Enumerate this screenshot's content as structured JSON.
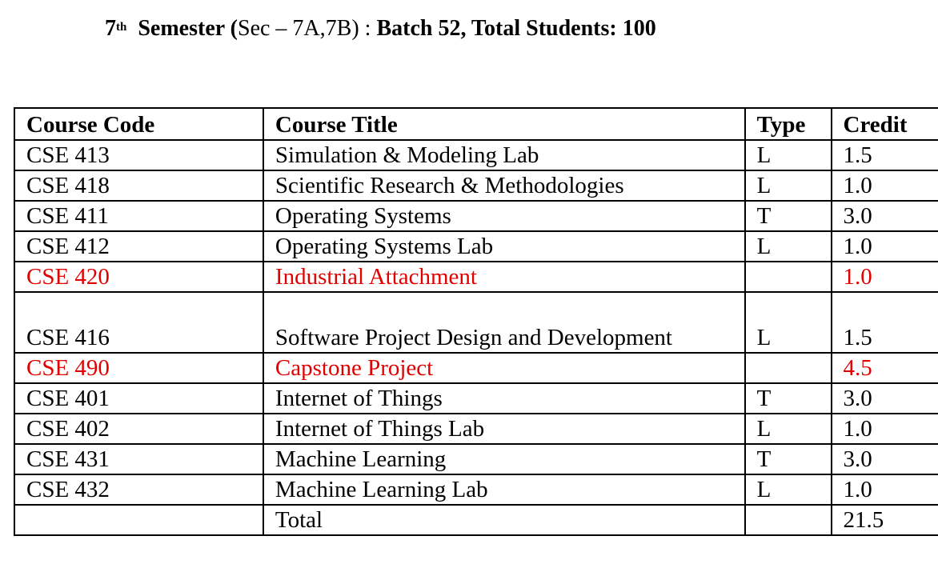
{
  "header": {
    "semester_num": "7",
    "semester_sup": "th",
    "semester_word": "Semester (",
    "section_text": "Sec – 7A,7B) : ",
    "batch_text": "Batch 52, Total Students: 100"
  },
  "table": {
    "columns": [
      "Course Code",
      "Course Title",
      "Type",
      "Credit"
    ],
    "rows": [
      {
        "code": "CSE 413",
        "title": "Simulation & Modeling Lab",
        "type": "L",
        "credit": "1.5"
      },
      {
        "code": "CSE 418",
        "title": "Scientific Research & Methodologies",
        "type": "L",
        "credit": "1.0"
      },
      {
        "code": "CSE 411",
        "title": "Operating Systems",
        "type": "T",
        "credit": "3.0"
      },
      {
        "code": "CSE 412",
        "title": "Operating Systems Lab",
        "type": "L",
        "credit": "1.0"
      },
      {
        "code": "CSE 420",
        "title": "Industrial Attachment",
        "type": "",
        "credit": "1.0"
      },
      {
        "code": "CSE 416",
        "title": "Software Project Design and Development",
        "type": "L",
        "credit": "1.5"
      },
      {
        "code": "CSE 490",
        "title": "Capstone Project",
        "type": "",
        "credit": "4.5"
      },
      {
        "code": "CSE 401",
        "title": "Internet of Things",
        "type": "T",
        "credit": "3.0"
      },
      {
        "code": "CSE 402",
        "title": "Internet of Things Lab",
        "type": "L",
        "credit": "1.0"
      },
      {
        "code": "CSE 431",
        "title": "Machine Learning",
        "type": "T",
        "credit": "3.0"
      },
      {
        "code": "CSE 432",
        "title": "Machine Learning Lab",
        "type": "L",
        "credit": "1.0"
      }
    ],
    "total_label": "Total",
    "total_value": "21.5"
  },
  "colors": {
    "highlight": "#e00000",
    "text": "#000000",
    "border": "#000000"
  }
}
